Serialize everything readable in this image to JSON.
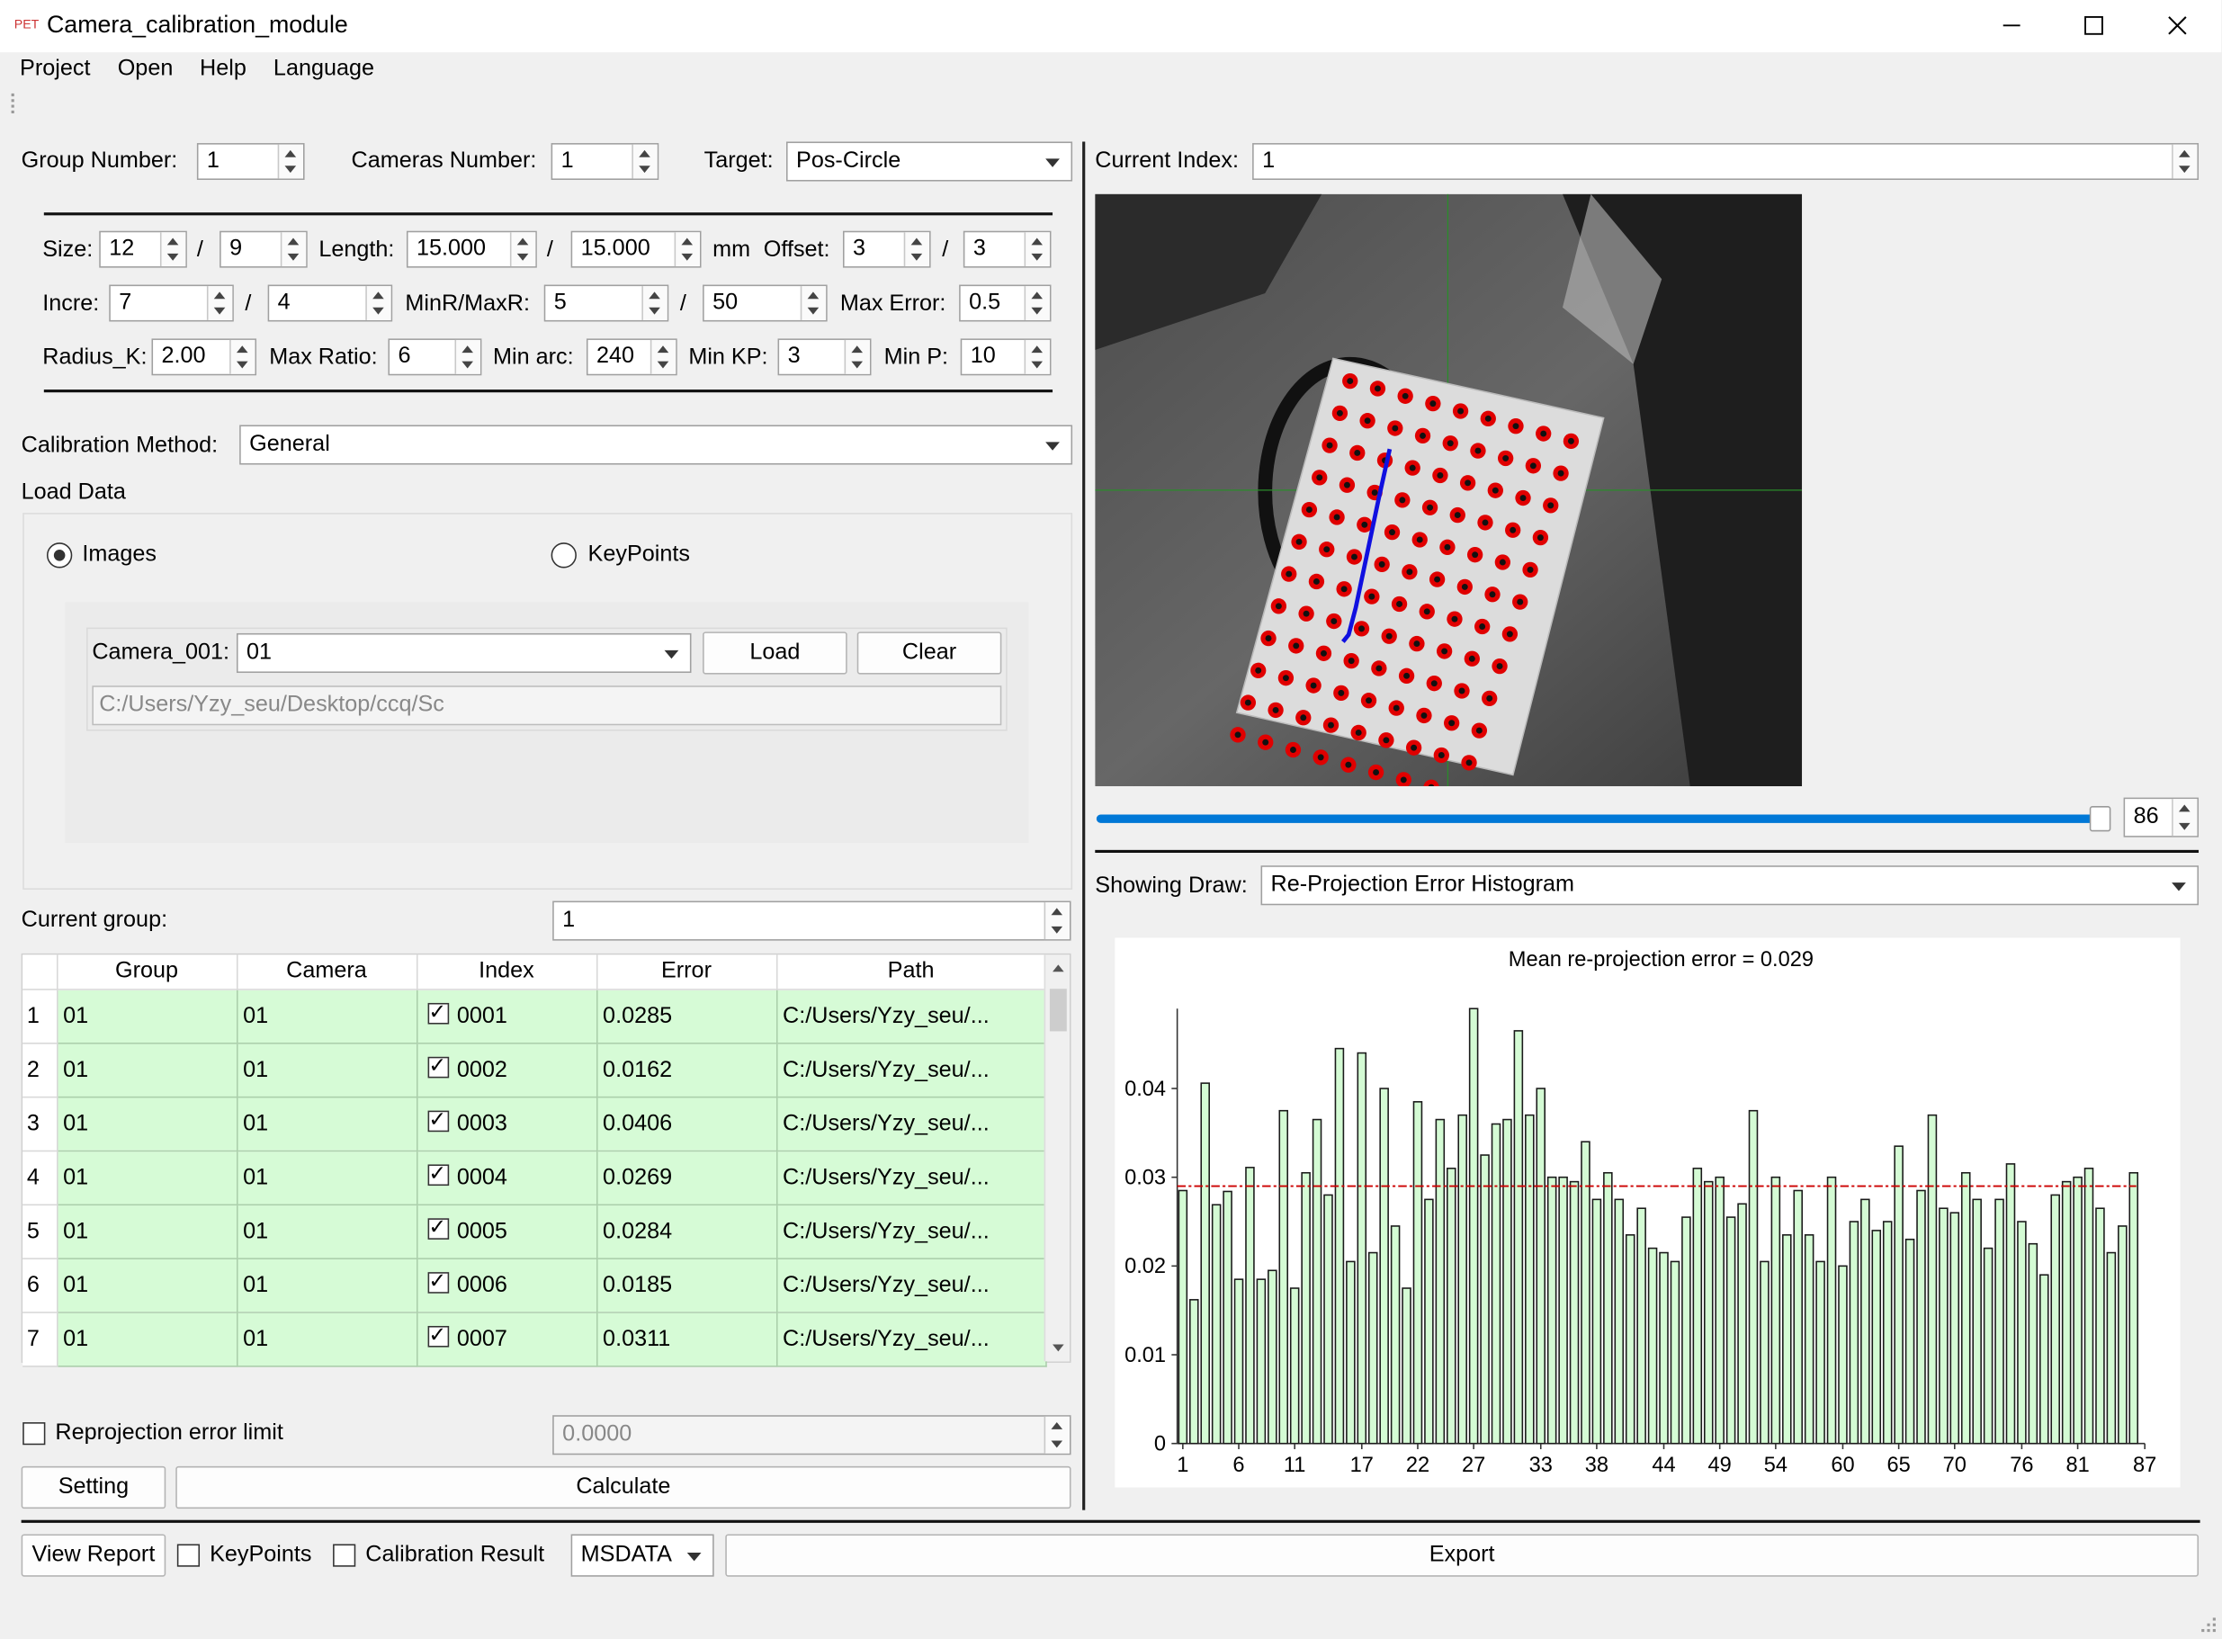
{
  "window": {
    "title": "Camera_calibration_module",
    "app_icon": "PET",
    "controls": [
      "minimize-icon",
      "maximize-icon",
      "close-icon"
    ]
  },
  "menu": [
    "Project",
    "Open",
    "Help",
    "Language"
  ],
  "params": {
    "group_number_label": "Group Number:",
    "group_number": "1",
    "cameras_number_label": "Cameras Number:",
    "cameras_number": "1",
    "target_label": "Target:",
    "target": "Pos-Circle",
    "size_label": "Size:",
    "size_a": "12",
    "size_b": "9",
    "length_label": "Length:",
    "length_a": "15.000",
    "length_b": "15.000",
    "unit": "mm",
    "offset_label": "Offset:",
    "offset_a": "3",
    "offset_b": "3",
    "incre_label": "Incre:",
    "incre_a": "7",
    "incre_b": "4",
    "minmax_label": "MinR/MaxR:",
    "minr": "5",
    "maxr": "50",
    "max_error_label": "Max Error:",
    "max_error": "0.5",
    "radius_k_label": "Radius_K:",
    "radius_k": "2.00",
    "max_ratio_label": "Max Ratio:",
    "max_ratio": "6",
    "min_arc_label": "Min arc:",
    "min_arc": "240",
    "min_kp_label": "Min KP:",
    "min_kp": "3",
    "min_p_label": "Min P:",
    "min_p": "10",
    "slash": "/"
  },
  "calibration": {
    "method_label": "Calibration Method:",
    "method": "General"
  },
  "load": {
    "title": "Load Data",
    "radio_images": "Images",
    "radio_keypoints": "KeyPoints",
    "camera_label": "Camera_001:",
    "camera_value": "01",
    "load_button": "Load",
    "clear_button": "Clear",
    "path": "C:/Users/Yzy_seu/Desktop/ccq/Sc"
  },
  "current_group": {
    "label": "Current group:",
    "value": "1"
  },
  "table": {
    "headers": [
      "Group",
      "Camera",
      "Index",
      "Error",
      "Path"
    ],
    "rows": [
      {
        "n": "1",
        "group": "01",
        "camera": "01",
        "index": "0001",
        "error": "0.0285",
        "path": "C:/Users/Yzy_seu/..."
      },
      {
        "n": "2",
        "group": "01",
        "camera": "01",
        "index": "0002",
        "error": "0.0162",
        "path": "C:/Users/Yzy_seu/..."
      },
      {
        "n": "3",
        "group": "01",
        "camera": "01",
        "index": "0003",
        "error": "0.0406",
        "path": "C:/Users/Yzy_seu/..."
      },
      {
        "n": "4",
        "group": "01",
        "camera": "01",
        "index": "0004",
        "error": "0.0269",
        "path": "C:/Users/Yzy_seu/..."
      },
      {
        "n": "5",
        "group": "01",
        "camera": "01",
        "index": "0005",
        "error": "0.0284",
        "path": "C:/Users/Yzy_seu/..."
      },
      {
        "n": "6",
        "group": "01",
        "camera": "01",
        "index": "0006",
        "error": "0.0185",
        "path": "C:/Users/Yzy_seu/..."
      },
      {
        "n": "7",
        "group": "01",
        "camera": "01",
        "index": "0007",
        "error": "0.0311",
        "path": "C:/Users/Yzy_seu/..."
      }
    ]
  },
  "reproj": {
    "checkbox_label": "Reprojection error limit",
    "value": "0.0000"
  },
  "actions": {
    "setting": "Setting",
    "calculate": "Calculate"
  },
  "bottom": {
    "view_report": "View Report",
    "keypoints": "KeyPoints",
    "calib_result": "Calibration Result",
    "format": "MSDATA",
    "export": "Export"
  },
  "viewer": {
    "current_index_label": "Current Index:",
    "current_index": "1",
    "slider_fraction": 0.99,
    "slider_value": "86"
  },
  "showing": {
    "label": "Showing Draw:",
    "value": "Re-Projection Error Histogram"
  },
  "colors": {
    "accent": "#0078d7",
    "bar_fill": "#d4fbd4",
    "mean_line": "#cc0000",
    "row_bg": "#d6fbd6"
  },
  "chart_data": {
    "type": "bar",
    "title": "Mean re-projection error = 0.029",
    "mean_line": 0.029,
    "ylim": [
      0,
      0.049
    ],
    "yticks": [
      0,
      0.01,
      0.02,
      0.03,
      0.04
    ],
    "ytick_labels": [
      "0",
      "0.01",
      "0.02",
      "0.03",
      "0.04"
    ],
    "xtick_labels": [
      "1",
      "6",
      "11",
      "17",
      "22",
      "27",
      "33",
      "38",
      "44",
      "49",
      "54",
      "60",
      "65",
      "70",
      "76",
      "81",
      "87"
    ],
    "xtick_positions": [
      1,
      6,
      11,
      17,
      22,
      27,
      33,
      38,
      44,
      49,
      54,
      60,
      65,
      70,
      76,
      81,
      87
    ],
    "categories": [
      1,
      2,
      3,
      4,
      5,
      6,
      7,
      8,
      9,
      10,
      11,
      12,
      13,
      14,
      15,
      16,
      17,
      18,
      19,
      20,
      21,
      22,
      23,
      24,
      25,
      26,
      27,
      28,
      29,
      30,
      31,
      32,
      33,
      34,
      35,
      36,
      37,
      38,
      39,
      40,
      41,
      42,
      43,
      44,
      45,
      46,
      47,
      48,
      49,
      50,
      51,
      52,
      53,
      54,
      55,
      56,
      57,
      58,
      59,
      60,
      61,
      62,
      63,
      64,
      65,
      66,
      67,
      68,
      69,
      70,
      71,
      72,
      73,
      74,
      75,
      76,
      77,
      78,
      79,
      80,
      81,
      82,
      83,
      84,
      85,
      86
    ],
    "values": [
      0.0285,
      0.0162,
      0.0406,
      0.0269,
      0.0284,
      0.0185,
      0.0311,
      0.0185,
      0.0195,
      0.0375,
      0.0175,
      0.0305,
      0.0365,
      0.028,
      0.0445,
      0.0205,
      0.044,
      0.0215,
      0.04,
      0.0245,
      0.0175,
      0.0385,
      0.0275,
      0.0365,
      0.031,
      0.037,
      0.049,
      0.0325,
      0.036,
      0.0365,
      0.0465,
      0.037,
      0.04,
      0.03,
      0.03,
      0.0295,
      0.034,
      0.0275,
      0.0305,
      0.0275,
      0.0235,
      0.0265,
      0.022,
      0.0215,
      0.0205,
      0.0255,
      0.031,
      0.0295,
      0.03,
      0.0255,
      0.027,
      0.0375,
      0.0205,
      0.03,
      0.0235,
      0.0285,
      0.0235,
      0.0205,
      0.03,
      0.02,
      0.025,
      0.0275,
      0.024,
      0.025,
      0.0335,
      0.023,
      0.0285,
      0.037,
      0.0265,
      0.026,
      0.0305,
      0.0275,
      0.022,
      0.0275,
      0.0315,
      0.025,
      0.0225,
      0.019,
      0.028,
      0.0295,
      0.03,
      0.031,
      0.0265,
      0.0215,
      0.0245,
      0.0305
    ]
  }
}
